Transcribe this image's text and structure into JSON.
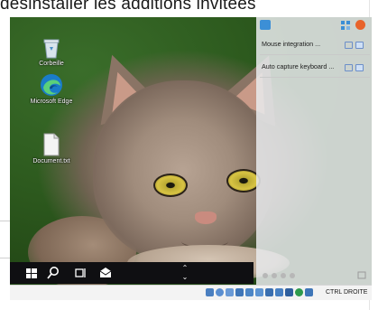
{
  "host_page": {
    "caption": "désinstaller les additions invitées"
  },
  "desktop": {
    "icons": [
      {
        "label": "Corbeille",
        "icon": "recycle-bin-icon"
      },
      {
        "label": "Microsoft Edge",
        "icon": "edge-browser-icon"
      },
      {
        "label": "Document.txt",
        "icon": "text-document-icon"
      }
    ]
  },
  "taskbar": {
    "icons": [
      "windows-start-icon",
      "search-icon",
      "task-view-icon",
      "mail-icon"
    ]
  },
  "side_panel": {
    "items": [
      {
        "label": "Mouse integration ..."
      },
      {
        "label": "Auto capture keyboard ..."
      }
    ]
  },
  "status_bar": {
    "host_key": "CTRL DROITE"
  },
  "colors": {
    "taskbar": "#0f0f12",
    "panel": "#e8eaec",
    "accent": "#3c8fd6"
  }
}
